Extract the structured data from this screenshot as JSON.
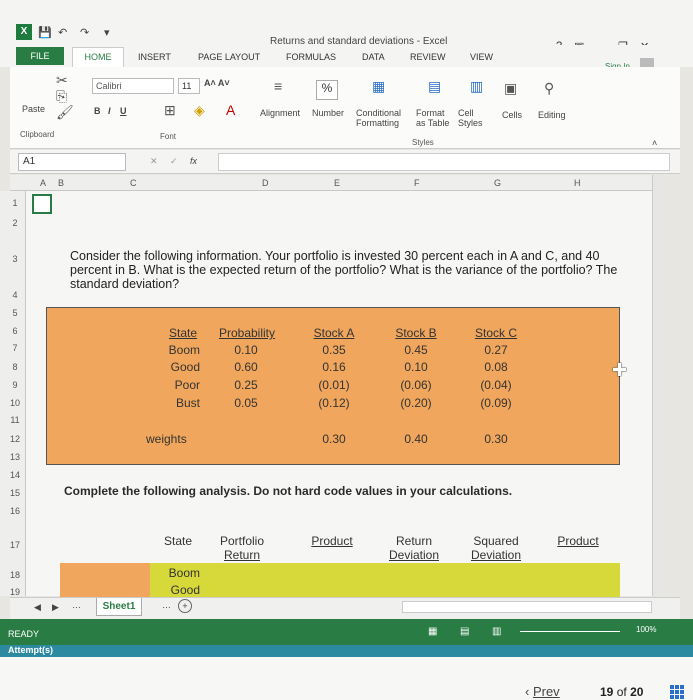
{
  "window": {
    "title": "Returns and standard deviations - Excel",
    "help": "?",
    "minimize": "–",
    "restore": "❐",
    "close": "✕"
  },
  "tabs": [
    "FILE",
    "HOME",
    "INSERT",
    "PAGE LAYOUT",
    "FORMULAS",
    "DATA",
    "REVIEW",
    "VIEW"
  ],
  "signin": "Sign In",
  "ribbon": {
    "paste": "Paste",
    "clipboard": "Clipboard",
    "font_name": "Calibri",
    "font_size": "11",
    "bold": "B",
    "italic": "I",
    "underline": "U",
    "font_group": "Font",
    "alignment": "Alignment",
    "number": "Number",
    "percent": "%",
    "conditional": "Conditional Formatting",
    "format_table": "Format as Table",
    "cell_styles": "Cell Styles",
    "styles_group": "Styles",
    "cells": "Cells",
    "editing": "Editing"
  },
  "formula_bar": {
    "name_box": "A1",
    "fx": "fx"
  },
  "columns": [
    "A",
    "B",
    "C",
    "D",
    "E",
    "F",
    "G",
    "H"
  ],
  "rows": [
    "1",
    "2",
    "3",
    "4",
    "5",
    "6",
    "7",
    "8",
    "9",
    "10",
    "11",
    "12",
    "13",
    "14",
    "15",
    "16",
    "17",
    "18",
    "19"
  ],
  "question": "Consider the following information. Your portfolio is invested 30 percent each in A and C, and 40 percent in B. What is the expected return of the portfolio? What is the variance of the portfolio? The standard deviation?",
  "table": {
    "headers": [
      "State",
      "Probability",
      "Stock A",
      "Stock B",
      "Stock C"
    ],
    "rows": [
      [
        "Boom",
        "0.10",
        "0.35",
        "0.45",
        "0.27"
      ],
      [
        "Good",
        "0.60",
        "0.16",
        "0.10",
        "0.08"
      ],
      [
        "Poor",
        "0.25",
        "(0.01)",
        "(0.06)",
        "(0.04)"
      ],
      [
        "Bust",
        "0.05",
        "(0.12)",
        "(0.20)",
        "(0.09)"
      ]
    ],
    "weights_label": "weights",
    "weights": [
      "0.30",
      "0.40",
      "0.30"
    ]
  },
  "instruction": "Complete the following analysis. Do not hard code values in your calculations.",
  "analysis": {
    "headers": [
      {
        "line1": "",
        "line2": "State"
      },
      {
        "line1": "Portfolio",
        "line2": "Return"
      },
      {
        "line1": "",
        "line2": "Product"
      },
      {
        "line1": "Return",
        "line2": "Deviation"
      },
      {
        "line1": "Squared",
        "line2": "Deviation"
      },
      {
        "line1": "",
        "line2": "Product"
      }
    ],
    "states": [
      "Boom",
      "Good"
    ]
  },
  "sheet_tab": "Sheet1",
  "status": {
    "ready": "READY",
    "zoom": "100%"
  },
  "attempts_label": "Attempt(s)",
  "pager": {
    "prev": "Prev",
    "current": "19",
    "of": "of",
    "total": "20"
  },
  "colors": {
    "excel_green": "#2a7c45",
    "table_orange": "#f0a65c",
    "input_yellow": "#d7d83a"
  }
}
